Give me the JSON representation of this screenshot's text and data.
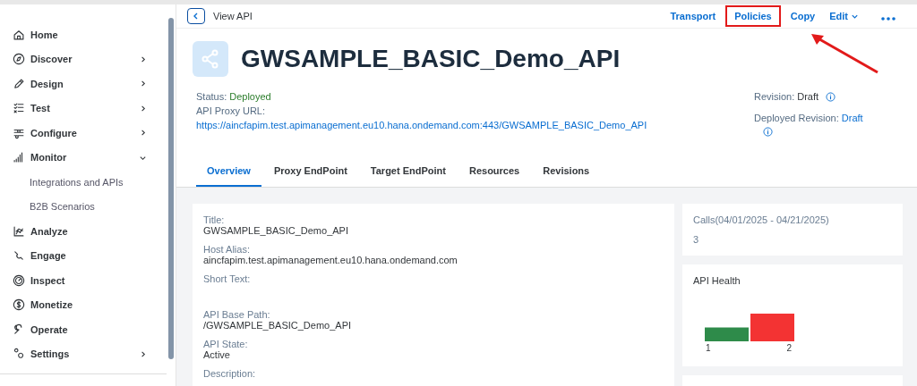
{
  "sidebar": {
    "items": [
      {
        "label": "Home",
        "kind": "main"
      },
      {
        "label": "Discover",
        "kind": "main",
        "expanded": false
      },
      {
        "label": "Design",
        "kind": "main",
        "expanded": false
      },
      {
        "label": "Test",
        "kind": "main",
        "expanded": false
      },
      {
        "label": "Configure",
        "kind": "main",
        "expanded": false
      },
      {
        "label": "Monitor",
        "kind": "main",
        "expanded": true
      },
      {
        "label": "Integrations and APIs",
        "kind": "sub"
      },
      {
        "label": "B2B Scenarios",
        "kind": "sub"
      },
      {
        "label": "Analyze",
        "kind": "main"
      },
      {
        "label": "Engage",
        "kind": "main"
      },
      {
        "label": "Inspect",
        "kind": "main"
      },
      {
        "label": "Monetize",
        "kind": "main"
      },
      {
        "label": "Operate",
        "kind": "main"
      },
      {
        "label": "Settings",
        "kind": "main",
        "expanded": false
      }
    ]
  },
  "header": {
    "title": "View API",
    "actions": [
      {
        "label": "Transport",
        "highlighted": false
      },
      {
        "label": "Policies",
        "highlighted": true
      },
      {
        "label": "Copy",
        "highlighted": false
      },
      {
        "label": "Edit",
        "highlighted": false,
        "kind": "menu"
      }
    ]
  },
  "api": {
    "name": "GWSAMPLE_BASIC_Demo_API",
    "status_label": "Status:",
    "status": "Deployed",
    "url_label": "API Proxy URL:",
    "url": "https://aincfapim.test.apimanagement.eu10.hana.ondemand.com:443/GWSAMPLE_BASIC_Demo_API",
    "revision_label": "Revision:",
    "revision": "Draft",
    "deployed_revision_label": "Deployed Revision:",
    "deployed_revision": "Draft"
  },
  "tabs": [
    {
      "label": "Overview",
      "selected": true
    },
    {
      "label": "Proxy EndPoint",
      "selected": false
    },
    {
      "label": "Target EndPoint",
      "selected": false
    },
    {
      "label": "Resources",
      "selected": false
    },
    {
      "label": "Revisions",
      "selected": false
    }
  ],
  "overview": {
    "fields": [
      {
        "label": "Title:",
        "value": "GWSAMPLE_BASIC_Demo_API"
      },
      {
        "label": "Host Alias:",
        "value": "aincfapim.test.apimanagement.eu10.hana.ondemand.com"
      },
      {
        "label": "Short Text:"
      },
      {
        "label": "API Base Path:",
        "value": "/GWSAMPLE_BASIC_Demo_API"
      },
      {
        "label": "API State:",
        "value": "Active"
      },
      {
        "label": "Description:"
      }
    ]
  },
  "calls": {
    "title": "Calls(04/01/2025 - 04/21/2025)",
    "value": "3"
  },
  "health": {
    "title": "API Health",
    "chart_data": {
      "type": "bar",
      "values": [
        1,
        2
      ],
      "colors": [
        "#2e8b4a",
        "#f33333"
      ],
      "data_labels": true
    }
  }
}
